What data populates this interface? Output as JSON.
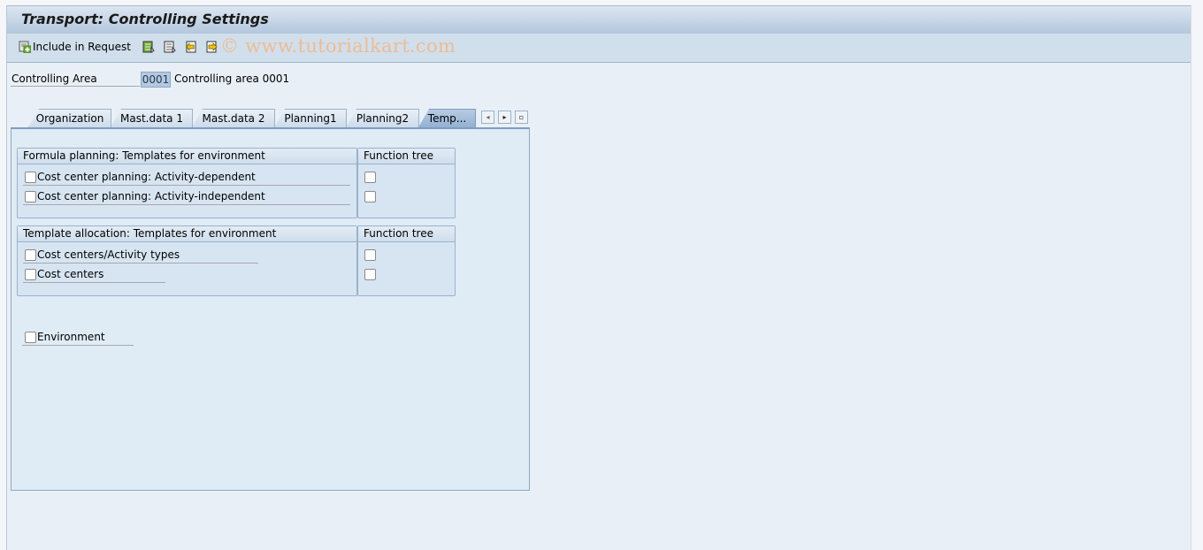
{
  "window": {
    "title": "Transport: Controlling Settings"
  },
  "toolbar": {
    "include_label": "Include in Request",
    "include_icon": "include-request-icon",
    "icons": [
      "select-all-icon",
      "deselect-all-icon",
      "import-icon",
      "export-icon"
    ],
    "watermark": "© www.tutorialkart.com"
  },
  "controlling_area": {
    "label": "Controlling Area",
    "value": "0001",
    "description": "Controlling area 0001"
  },
  "tabs": [
    {
      "label": "Organization",
      "active": false
    },
    {
      "label": "Mast.data 1",
      "active": false
    },
    {
      "label": "Mast.data 2",
      "active": false
    },
    {
      "label": "Planning1",
      "active": false
    },
    {
      "label": "Planning2",
      "active": false
    },
    {
      "label": "Temp...",
      "active": true
    }
  ],
  "tab_nav": {
    "prev_icon": "◂",
    "next_icon": "▸",
    "list_icon": "▫"
  },
  "formula_group": {
    "title": "Formula planning: Templates for environment",
    "function_tree_title": "Function tree",
    "items": [
      {
        "label": "Cost center planning: Activity-dependent",
        "checked": false,
        "function_tree_checked": false
      },
      {
        "label": "Cost center planning: Activity-independent",
        "checked": false,
        "function_tree_checked": false
      }
    ]
  },
  "allocation_group": {
    "title": "Template allocation: Templates for environment",
    "function_tree_title": "Function tree",
    "items": [
      {
        "label": "Cost centers/Activity types",
        "checked": false,
        "function_tree_checked": false
      },
      {
        "label": "Cost centers",
        "checked": false,
        "function_tree_checked": false
      }
    ]
  },
  "environment": {
    "label": "Environment",
    "checked": false
  }
}
